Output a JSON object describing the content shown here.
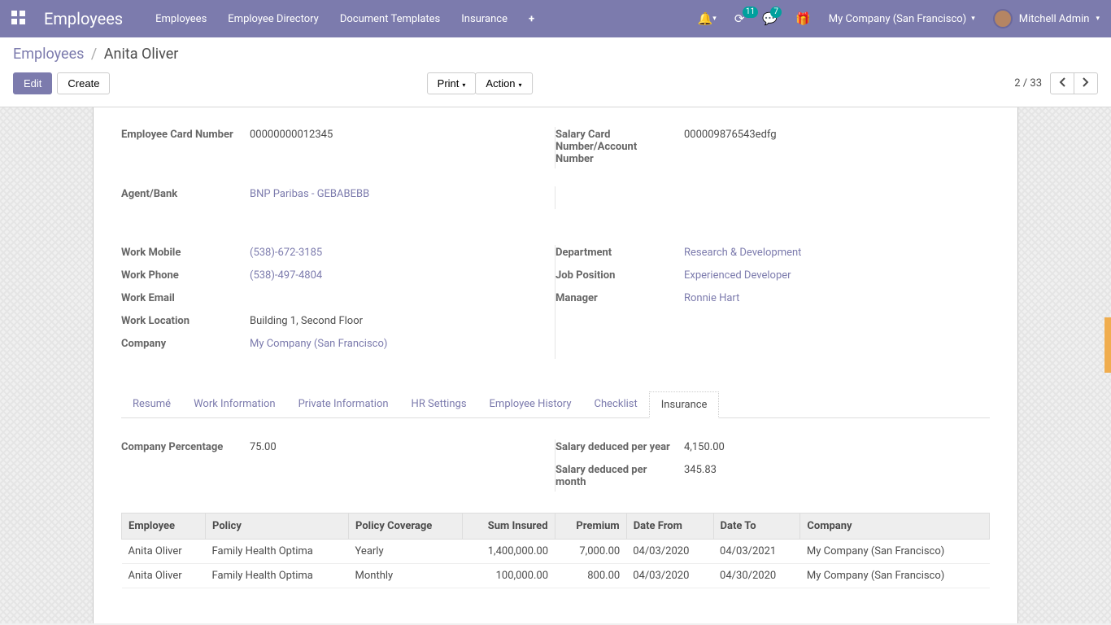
{
  "nav": {
    "brand": "Employees",
    "links": [
      "Employees",
      "Employee Directory",
      "Document Templates",
      "Insurance"
    ],
    "badges": {
      "activities": "11",
      "messages": "7"
    },
    "company": "My Company (San Francisco)",
    "user": "Mitchell Admin"
  },
  "breadcrumb": {
    "root": "Employees",
    "current": "Anita Oliver"
  },
  "buttons": {
    "edit": "Edit",
    "create": "Create",
    "print": "Print",
    "action": "Action"
  },
  "pager": {
    "pos": "2 / 33"
  },
  "fields": {
    "emp_card_label": "Employee Card Number",
    "emp_card_val": "00000000012345",
    "salary_card_label": "Salary Card Number/Account Number",
    "salary_card_val": "000009876543edfg",
    "agent_bank_label": "Agent/Bank",
    "agent_bank_val": "BNP Paribas - GEBABEBB",
    "work_mobile_label": "Work Mobile",
    "work_mobile_val": "(538)-672-3185",
    "work_phone_label": "Work Phone",
    "work_phone_val": "(538)-497-4804",
    "work_email_label": "Work Email",
    "work_location_label": "Work Location",
    "work_location_val": "Building 1, Second Floor",
    "company_label": "Company",
    "company_val": "My Company (San Francisco)",
    "department_label": "Department",
    "department_val": "Research & Development",
    "job_label": "Job Position",
    "job_val": "Experienced Developer",
    "manager_label": "Manager",
    "manager_val": "Ronnie Hart"
  },
  "tabs": [
    "Resumé",
    "Work Information",
    "Private Information",
    "HR Settings",
    "Employee History",
    "Checklist",
    "Insurance"
  ],
  "active_tab": "Insurance",
  "insurance_summary": {
    "company_pct_label": "Company Percentage",
    "company_pct_val": "75.00",
    "salary_year_label": "Salary deduced per year",
    "salary_year_val": "4,150.00",
    "salary_month_label": "Salary deduced per month",
    "salary_month_val": "345.83"
  },
  "ins_table": {
    "headers": [
      "Employee",
      "Policy",
      "Policy Coverage",
      "Sum Insured",
      "Premium",
      "Date From",
      "Date To",
      "Company"
    ],
    "rows": [
      [
        "Anita Oliver",
        "Family Health Optima",
        "Yearly",
        "1,400,000.00",
        "7,000.00",
        "04/03/2020",
        "04/03/2021",
        "My Company (San Francisco)"
      ],
      [
        "Anita Oliver",
        "Family Health Optima",
        "Monthly",
        "100,000.00",
        "800.00",
        "04/03/2020",
        "04/30/2020",
        "My Company (San Francisco)"
      ]
    ]
  }
}
